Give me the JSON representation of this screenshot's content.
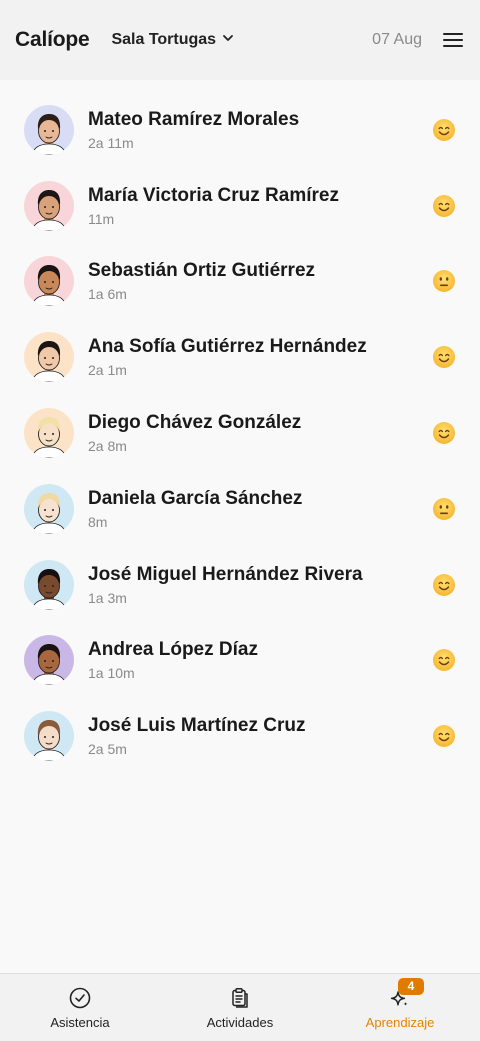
{
  "header": {
    "brand": "Calíope",
    "room": "Sala Tortugas",
    "date": "07 Aug"
  },
  "students": [
    {
      "name": "Mateo Ramírez Morales",
      "age": "2a 11m",
      "mood": "happy",
      "avatar_bg": "#d9dcf5",
      "skin": "#e8b896",
      "hair": "#2a1f1a"
    },
    {
      "name": "María Victoria Cruz Ramírez",
      "age": "11m",
      "mood": "happy",
      "avatar_bg": "#f8d5d8",
      "skin": "#d9a27a",
      "hair": "#1e1614"
    },
    {
      "name": "Sebastián Ortiz Gutiérrez",
      "age": "1a 6m",
      "mood": "neutral",
      "avatar_bg": "#f8d5d8",
      "skin": "#c98858",
      "hair": "#1a1412"
    },
    {
      "name": "Ana Sofía Gutiérrez Hernández",
      "age": "2a 1m",
      "mood": "happy",
      "avatar_bg": "#fce3c8",
      "skin": "#f1c9a8",
      "hair": "#1c1614"
    },
    {
      "name": "Diego Chávez González",
      "age": "2a 8m",
      "mood": "happy",
      "avatar_bg": "#fce3c8",
      "skin": "#f7e0c6",
      "hair": "#f2e1a6"
    },
    {
      "name": "Daniela García Sánchez",
      "age": "8m",
      "mood": "neutral",
      "avatar_bg": "#cfe8f3",
      "skin": "#f6e2cf",
      "hair": "#f0d9a2"
    },
    {
      "name": "José Miguel Hernández Rivera",
      "age": "1a 3m",
      "mood": "happy",
      "avatar_bg": "#cfe8f3",
      "skin": "#7a4a2e",
      "hair": "#161010"
    },
    {
      "name": "Andrea López Díaz",
      "age": "1a 10m",
      "mood": "happy",
      "avatar_bg": "#c9b7e6",
      "skin": "#a8673e",
      "hair": "#1a1210"
    },
    {
      "name": "José Luis Martínez Cruz",
      "age": "2a 5m",
      "mood": "happy",
      "avatar_bg": "#cfe8f3",
      "skin": "#f5dcc8",
      "hair": "#8a5a3c"
    }
  ],
  "nav": {
    "items": [
      {
        "label": "Asistencia",
        "icon": "check-circle-icon"
      },
      {
        "label": "Actividades",
        "icon": "clipboard-icon"
      },
      {
        "label": "Aprendizaje",
        "icon": "sparkles-icon",
        "badge": "4",
        "active": true
      }
    ],
    "active_color": "#e08600"
  }
}
